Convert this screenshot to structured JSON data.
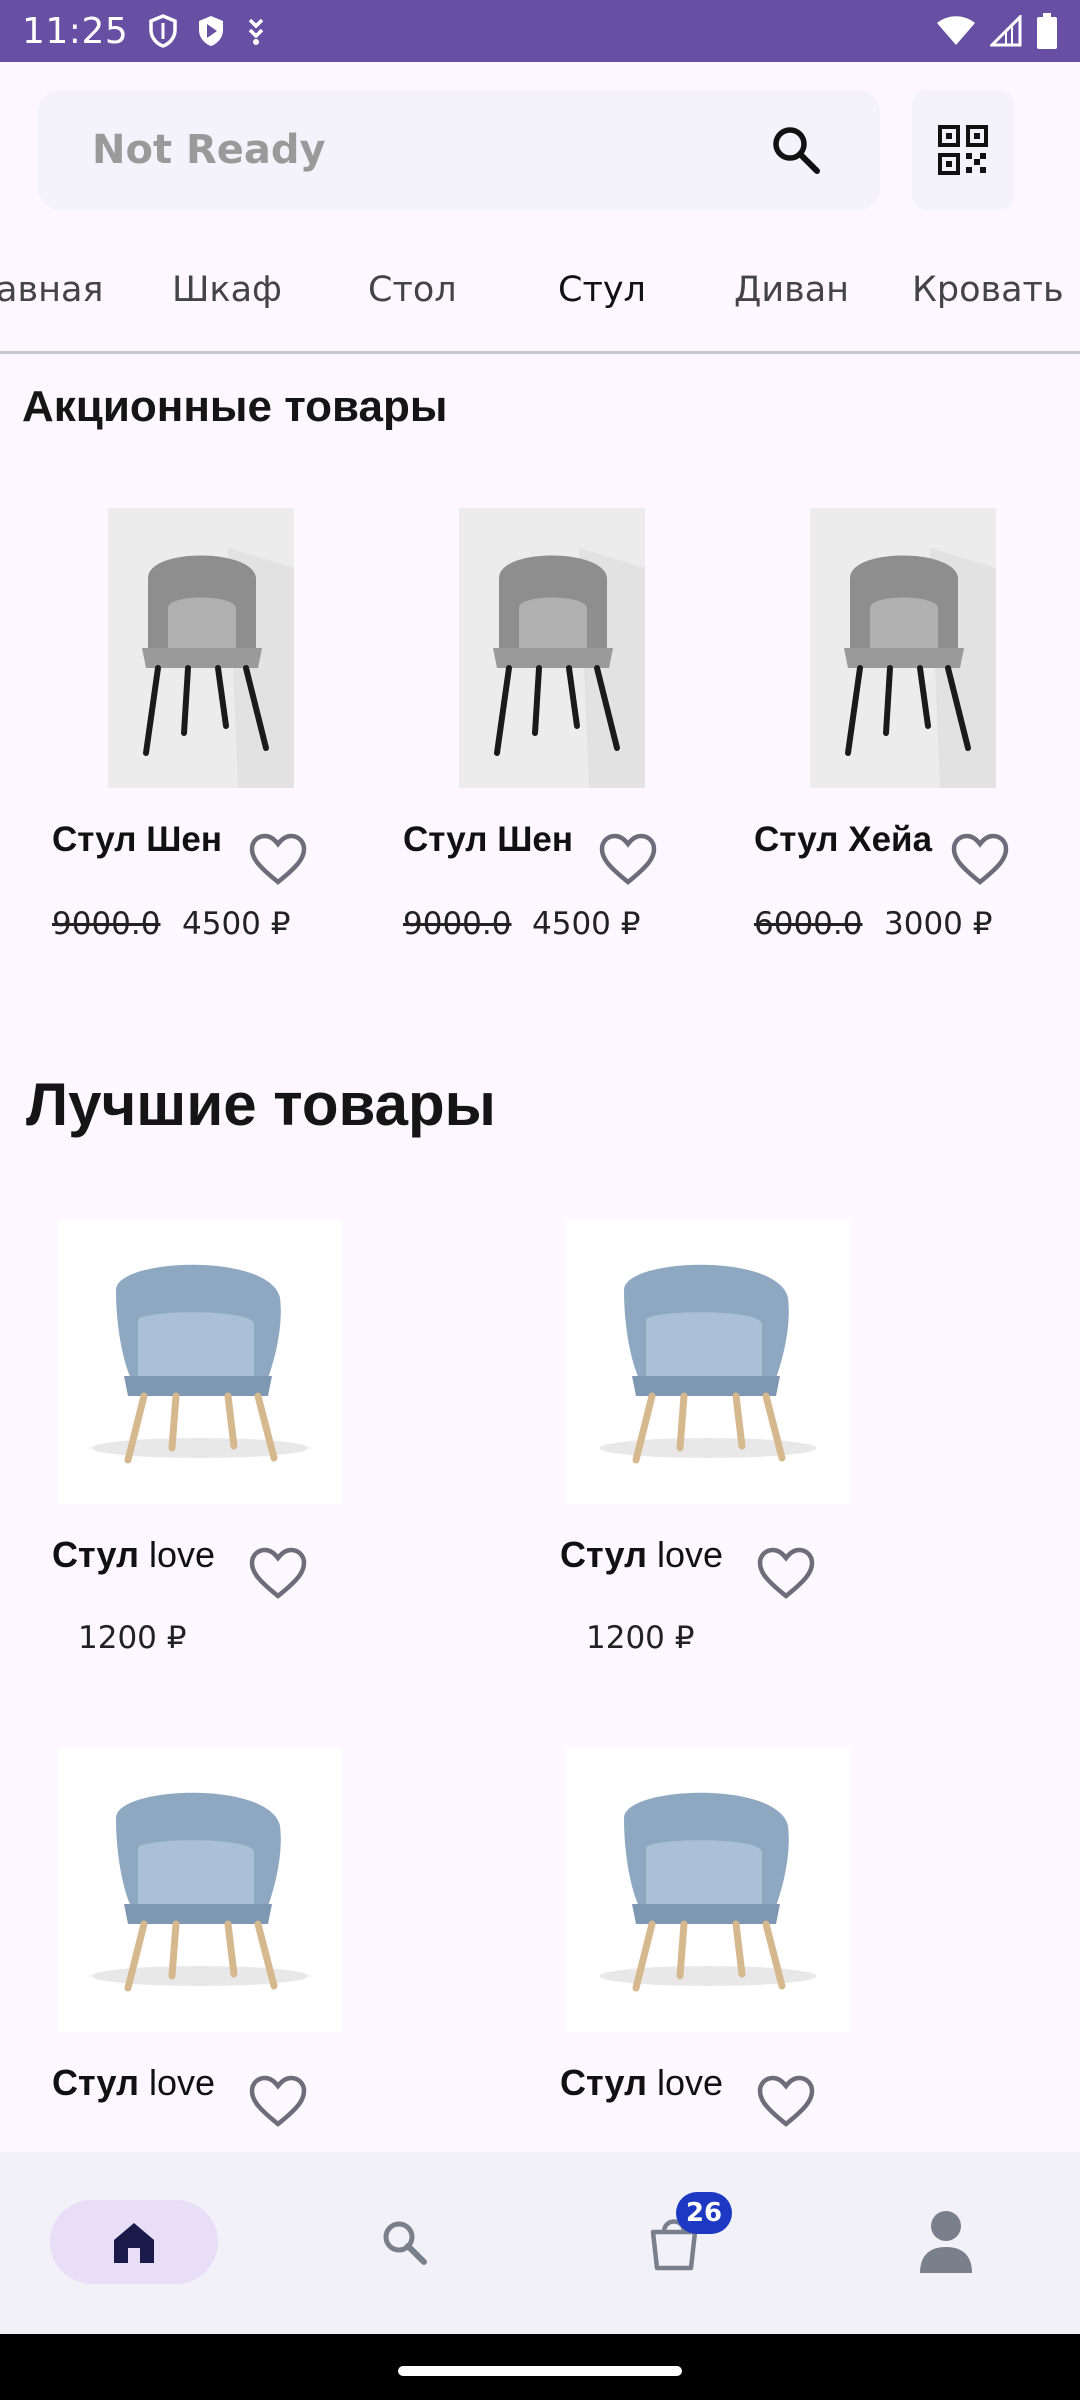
{
  "status_bar": {
    "time": "11:25",
    "left_icons": [
      "shield-icon",
      "play-shield-icon",
      "download-icon"
    ],
    "right_icons": [
      "wifi-icon",
      "signal-icon",
      "battery-icon"
    ]
  },
  "search": {
    "placeholder": "Not Ready",
    "search_icon": "search-icon",
    "qr_icon": "qr-code-icon"
  },
  "categories": {
    "items": [
      {
        "label": "авная",
        "active": false
      },
      {
        "label": "Шкаф",
        "active": false
      },
      {
        "label": "Стол",
        "active": false
      },
      {
        "label": "Стул",
        "active": true
      },
      {
        "label": "Диван",
        "active": false
      },
      {
        "label": "Кровать",
        "active": false
      }
    ]
  },
  "promo": {
    "title": "Акционные товары",
    "items": [
      {
        "name": "Стул Шен",
        "old_price": "9000.0",
        "price": "4500 ₽"
      },
      {
        "name": "Стул Шен",
        "old_price": "9000.0",
        "price": "4500 ₽"
      },
      {
        "name": "Стул Хейа",
        "old_price": "6000.0",
        "price": "3000 ₽"
      }
    ]
  },
  "best": {
    "title": "Лучшие товары",
    "items": [
      {
        "name_bold": "Стул",
        "name_rest": " love",
        "price": "1200 ₽"
      },
      {
        "name_bold": "Стул",
        "name_rest": " love",
        "price": "1200 ₽"
      },
      {
        "name_bold": "Стул",
        "name_rest": " love",
        "price": ""
      },
      {
        "name_bold": "Стул",
        "name_rest": " love",
        "price": ""
      }
    ]
  },
  "bottom_nav": {
    "items": [
      {
        "icon": "home-icon",
        "active": true
      },
      {
        "icon": "search-icon",
        "active": false
      },
      {
        "icon": "shopping-bag-icon",
        "active": false,
        "badge": "26"
      },
      {
        "icon": "profile-icon",
        "active": false
      }
    ]
  },
  "colors": {
    "status_bar": "#6750a4",
    "background": "#fdf7ff",
    "nav_active": "#e8def8",
    "nav_icon_active": "#1a1b4b",
    "nav_icon": "#7a7f8c",
    "badge": "#1d39c4",
    "heart": "#6d6d7a"
  }
}
